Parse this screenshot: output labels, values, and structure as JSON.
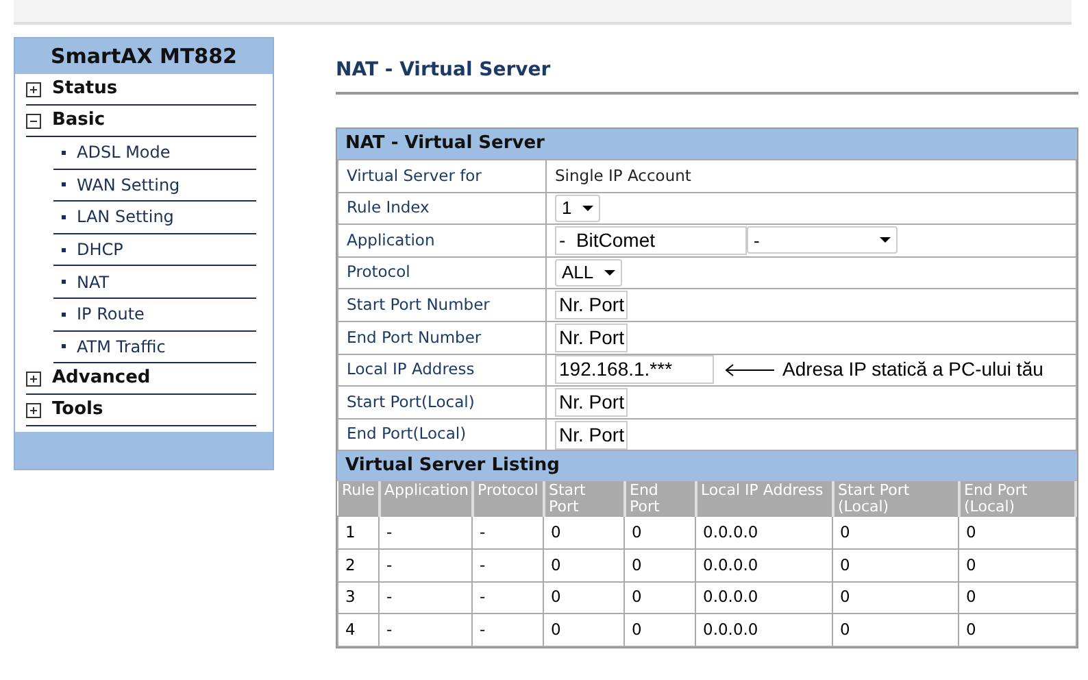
{
  "sidebar": {
    "title": "SmartAX MT882",
    "items": [
      {
        "label": "Status",
        "expanded": false
      },
      {
        "label": "Basic",
        "expanded": true,
        "children": [
          {
            "label": "ADSL Mode"
          },
          {
            "label": "WAN Setting"
          },
          {
            "label": "LAN Setting"
          },
          {
            "label": "DHCP"
          },
          {
            "label": "NAT"
          },
          {
            "label": "IP Route"
          },
          {
            "label": "ATM Traffic"
          }
        ]
      },
      {
        "label": "Advanced",
        "expanded": false
      },
      {
        "label": "Tools",
        "expanded": false
      }
    ]
  },
  "page_title": "NAT - Virtual Server",
  "form": {
    "title": "NAT - Virtual Server",
    "rows": [
      {
        "label": "Virtual Server for",
        "kind": "text",
        "value": "Single IP Account"
      },
      {
        "label": "Rule Index",
        "kind": "select",
        "value": "1"
      },
      {
        "label": "Application",
        "kind": "app",
        "value": "-  BitComet",
        "select_value": "-"
      },
      {
        "label": "Protocol",
        "kind": "select",
        "value": "ALL"
      },
      {
        "label": "Start Port Number",
        "kind": "input",
        "value": "Nr. Port"
      },
      {
        "label": "End Port Number",
        "kind": "input",
        "value": "Nr. Port"
      },
      {
        "label": "Local IP Address",
        "kind": "input-note",
        "value": "192.168.1.***",
        "note": "Adresa IP statică a PC-ului tău"
      },
      {
        "label": "Start Port(Local)",
        "kind": "input",
        "value": "Nr. Port"
      },
      {
        "label": "End Port(Local)",
        "kind": "input",
        "value": "Nr. Port"
      }
    ]
  },
  "listing": {
    "title": "Virtual Server Listing",
    "columns": [
      "Rule",
      "Application",
      "Protocol",
      "Start Port",
      "End Port",
      "Local IP Address",
      "Start Port (Local)",
      "End Port (Local)"
    ],
    "rows": [
      [
        "1",
        "-",
        "-",
        "0",
        "0",
        "0.0.0.0",
        "0",
        "0"
      ],
      [
        "2",
        "-",
        "-",
        "0",
        "0",
        "0.0.0.0",
        "0",
        "0"
      ],
      [
        "3",
        "-",
        "-",
        "0",
        "0",
        "0.0.0.0",
        "0",
        "0"
      ],
      [
        "4",
        "-",
        "-",
        "0",
        "0",
        "0.0.0.0",
        "0",
        "0"
      ]
    ]
  }
}
